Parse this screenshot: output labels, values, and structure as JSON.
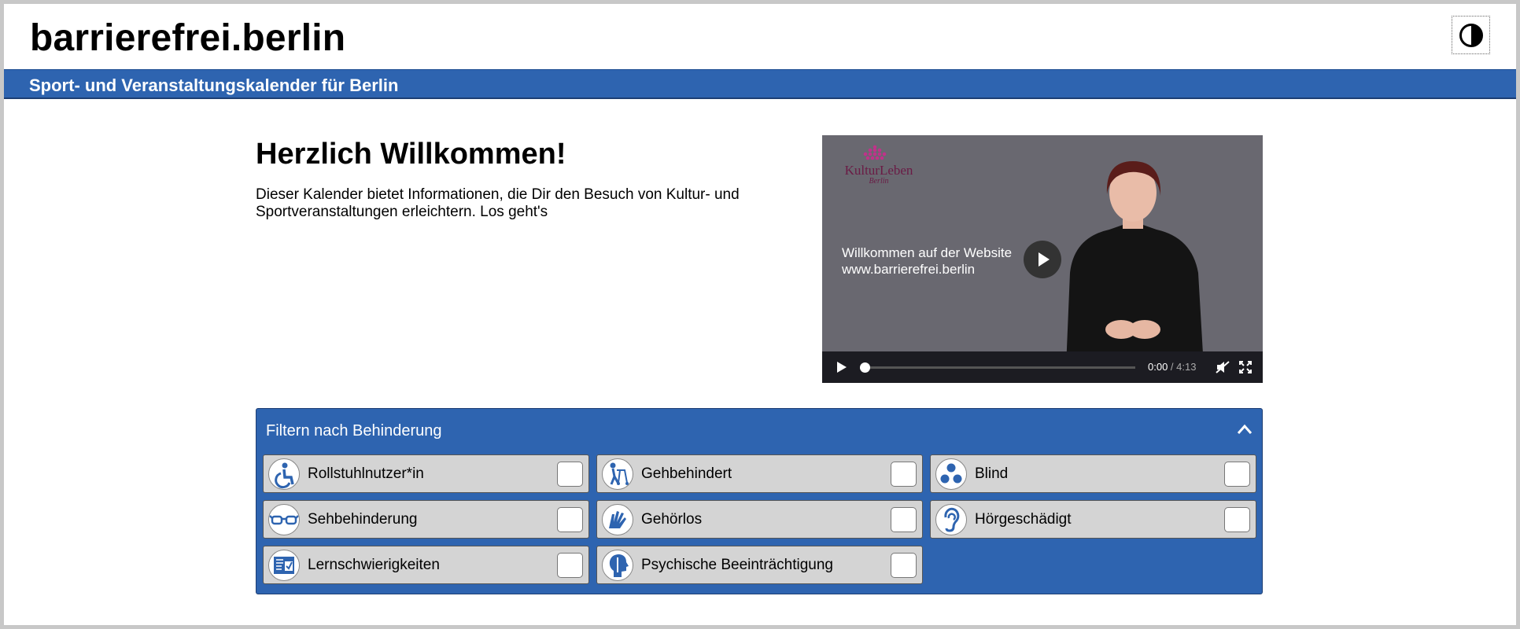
{
  "header": {
    "site_title": "barrierefrei.berlin",
    "subtitle": "Sport- und Veranstaltungskalender für Berlin",
    "contrast_icon": "contrast-icon"
  },
  "welcome": {
    "heading": "Herzlich Willkommen!",
    "text": "Dieser Kalender bietet Informationen, die Dir den Besuch von Kultur- und Sportveranstaltungen erleichtern. Los geht's"
  },
  "video": {
    "logo_text": "KulturLeben",
    "logo_sub": "Berlin",
    "caption_line1": "Willkommen auf der Website",
    "caption_line2": "www.barrierefrei.berlin",
    "current_time": "0:00",
    "separator": " / ",
    "duration": "4:13",
    "progress_fraction": 0.0
  },
  "filter": {
    "title": "Filtern nach Behinderung",
    "expanded": true,
    "items": [
      {
        "label": "Rollstuhlnutzer*in",
        "icon": "wheelchair-icon",
        "checked": false
      },
      {
        "label": "Gehbehindert",
        "icon": "walker-icon",
        "checked": false
      },
      {
        "label": "Blind",
        "icon": "braille-icon",
        "checked": false
      },
      {
        "label": "Sehbehinderung",
        "icon": "glasses-icon",
        "checked": false
      },
      {
        "label": "Gehörlos",
        "icon": "sign-language-icon",
        "checked": false
      },
      {
        "label": "Hörgeschädigt",
        "icon": "ear-icon",
        "checked": false
      },
      {
        "label": "Lernschwierigkeiten",
        "icon": "easy-read-icon",
        "checked": false
      },
      {
        "label": "Psychische Beeinträchtigung",
        "icon": "head-profile-icon",
        "checked": false
      }
    ]
  },
  "colors": {
    "brand_blue": "#2e64b0",
    "item_grey": "#d4d4d4",
    "video_bg": "#696870"
  }
}
